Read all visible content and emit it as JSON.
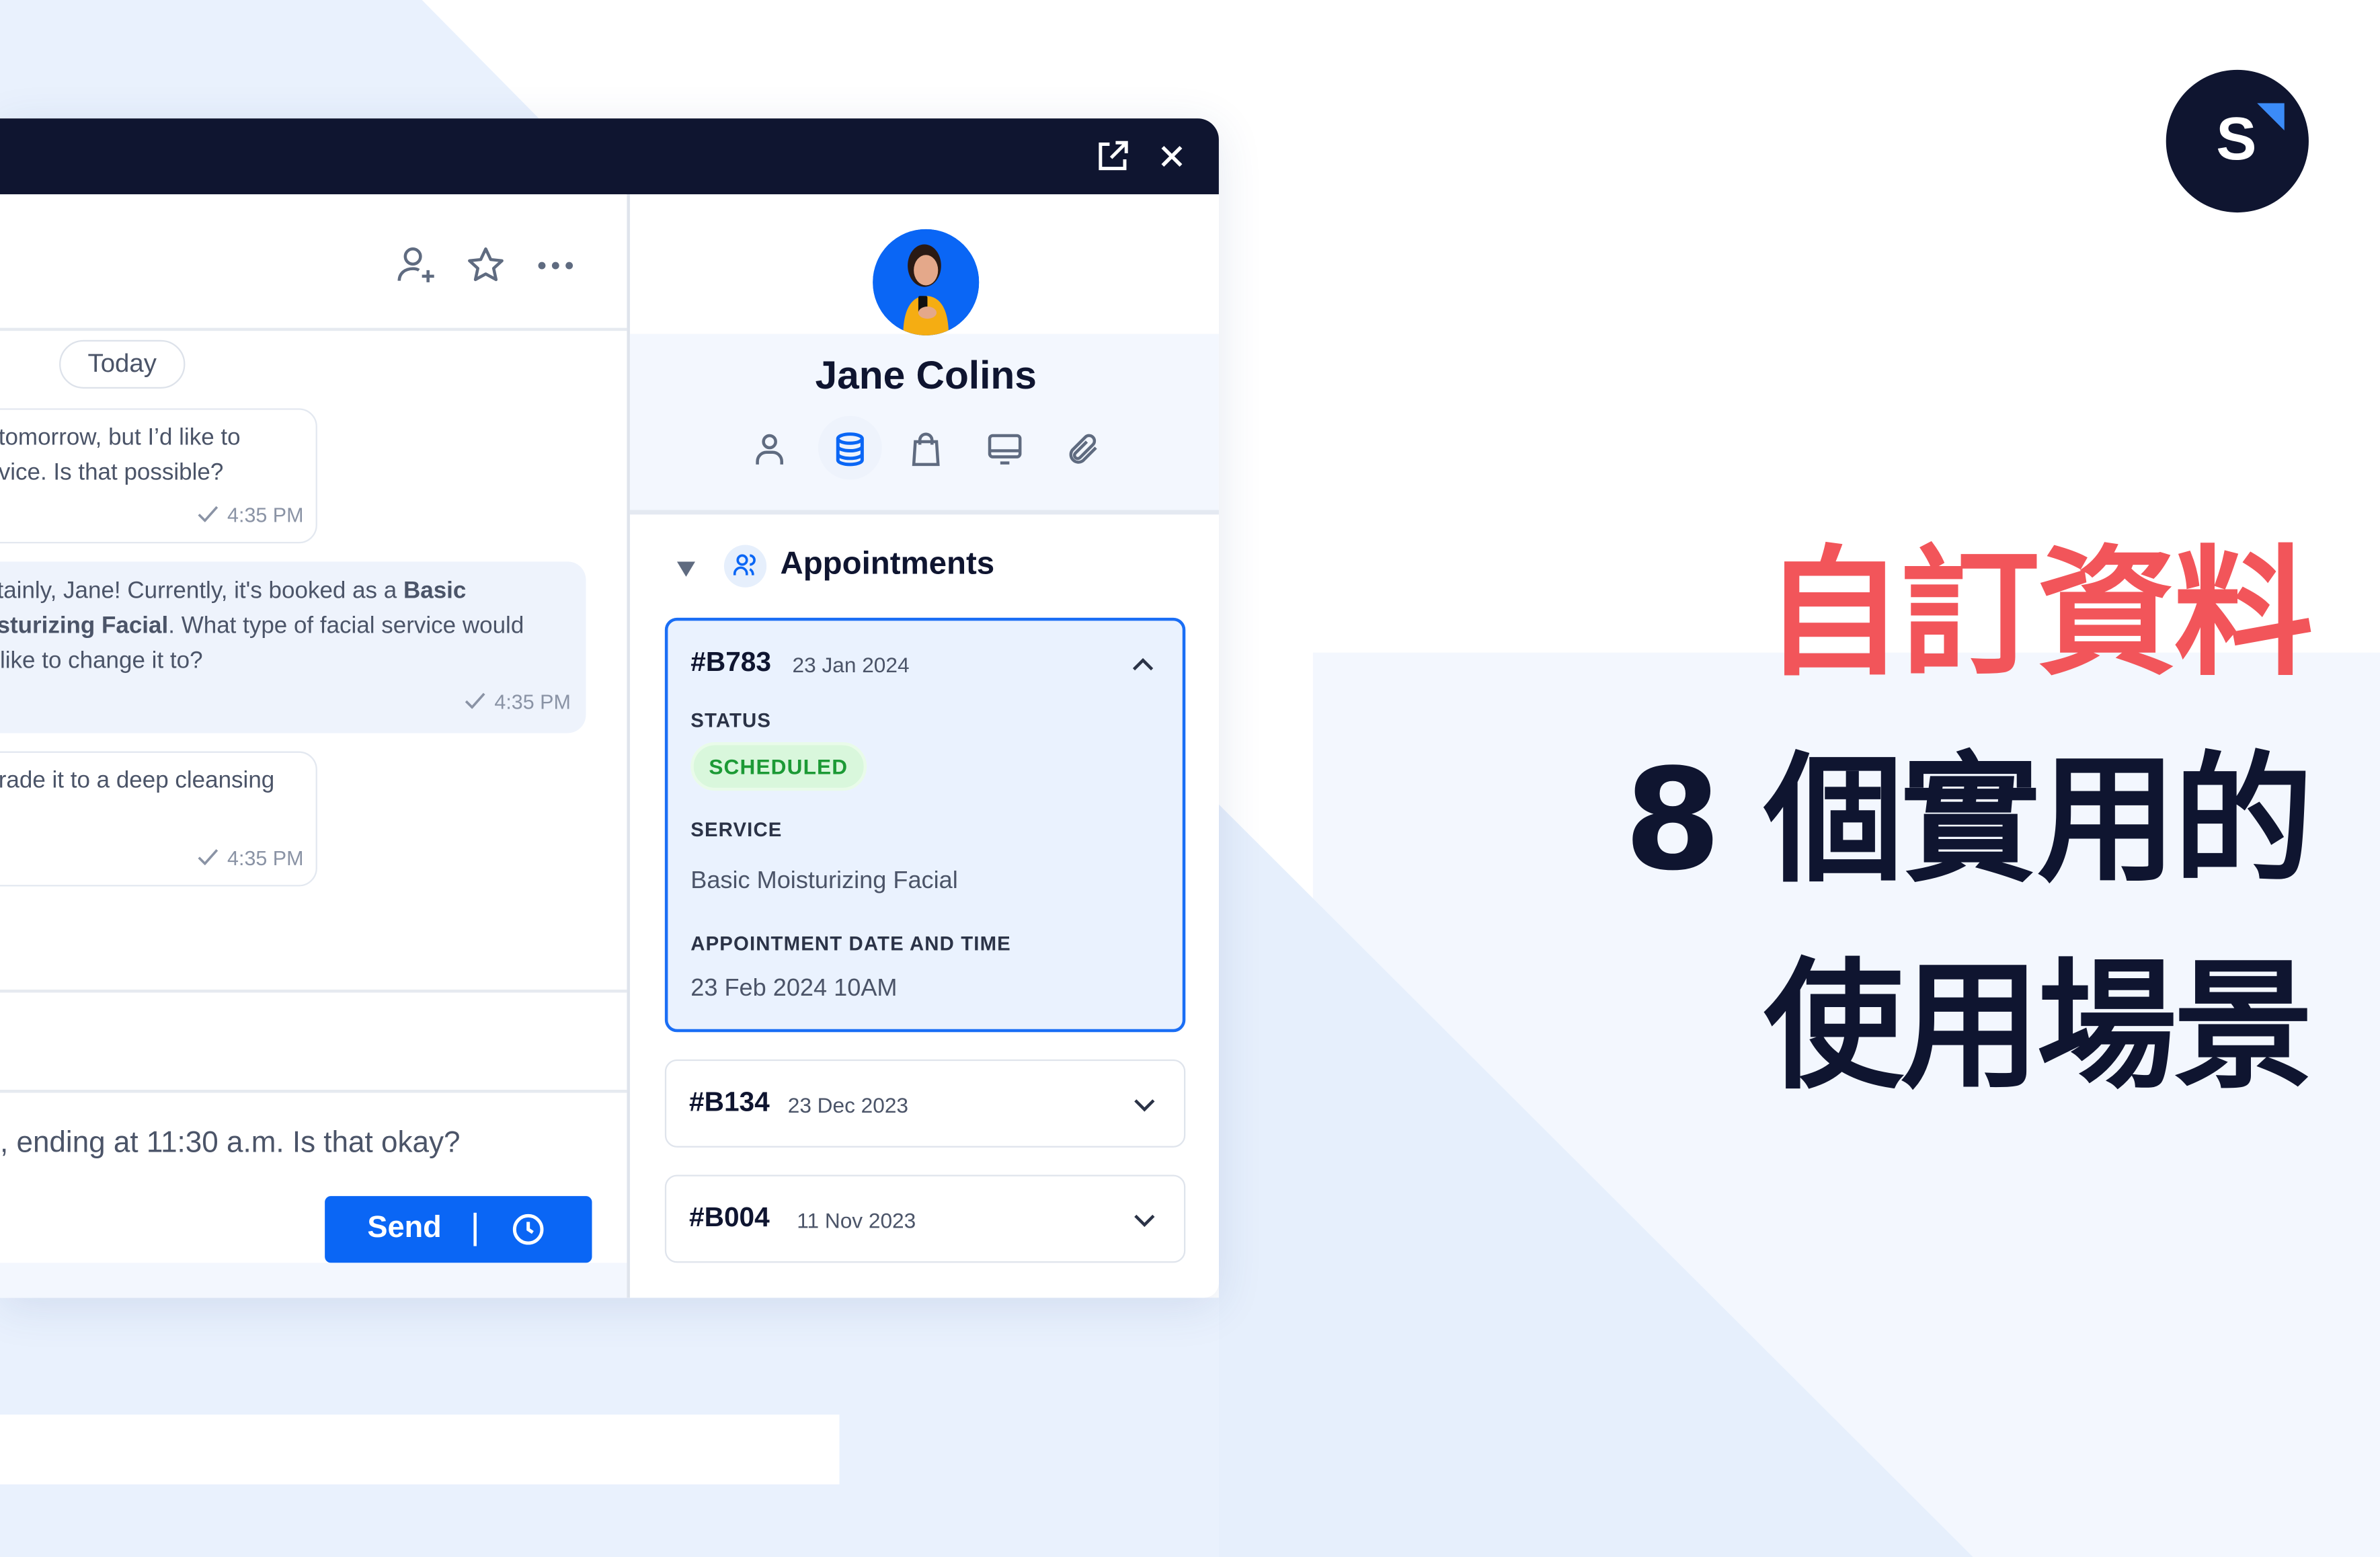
{
  "colors": {
    "brand_dark": "#0f1530",
    "accent_blue": "#0a66f5",
    "headline_red": "#f2555a",
    "status_green": "#1c9a35"
  },
  "window": {
    "header_icons": [
      "external-link-icon",
      "close-icon"
    ]
  },
  "chat": {
    "toolbar_icons": [
      "add-user-icon",
      "star-icon",
      "more-icon"
    ],
    "date_divider": "Today",
    "messages": [
      {
        "lines": [
          "tomorrow, but I’d like to",
          "vice. Is that possible?"
        ],
        "time": "4:35 PM"
      },
      {
        "line1_pre": "tainly, Jane! Currently, it's booked as a ",
        "line1_bold": "Basic",
        "line2_bold": "sturizing Facial",
        "line2_post": ". What type of facial service would",
        "line3": "like to change it to?",
        "time": "4:35 PM"
      },
      {
        "lines": [
          "rade it to a deep cleansing"
        ],
        "time": "4:35 PM"
      }
    ],
    "composer_text": ", ending at 11:30 a.m. Is that okay?",
    "send_label": "Send"
  },
  "profile": {
    "name": "Jane Colins",
    "tabs": [
      "person-icon",
      "database-icon",
      "shopping-bag-icon",
      "monitor-icon",
      "paperclip-icon"
    ],
    "active_tab": "database-icon"
  },
  "appointments": {
    "title": "Appointments",
    "items": [
      {
        "id": "#B783",
        "date": "23 Jan 2024",
        "expanded": true,
        "status_label": "STATUS",
        "status": "SCHEDULED",
        "service_label": "SERVICE",
        "service": "Basic Moisturizing Facial",
        "datetime_label": "APPOINTMENT DATE AND TIME",
        "datetime": "23 Feb 2024 10AM"
      },
      {
        "id": "#B134",
        "date": "23 Dec 2023",
        "expanded": false
      },
      {
        "id": "#B004",
        "date": "11 Nov 2023",
        "expanded": false
      }
    ]
  },
  "headline": {
    "line1": "自訂資料",
    "line2": "8 個實用的",
    "line3": "使用場景"
  },
  "logo": {
    "letter": "S"
  }
}
